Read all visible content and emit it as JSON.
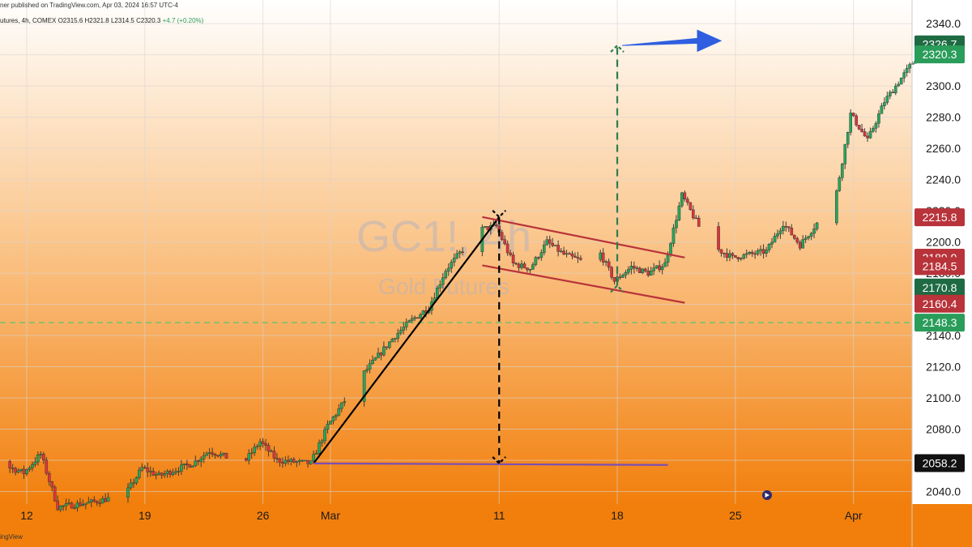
{
  "header": {
    "published": "ner published on TradingView.com, Apr 03, 2024 16:57 UTC-4",
    "ohlc": "utures, 4h, COMEX  O2315.6  H2321.8  L2314.5  C2320.3",
    "change": "+4.7 (+0.20%)"
  },
  "watermark": {
    "symbol": "GC1!, 4h",
    "name": "Gold Futures"
  },
  "footer": {
    "brand": "ingView"
  },
  "colors": {
    "up": "#26a65b",
    "down": "#d9363e",
    "trend": "#b8333a",
    "arrow": "#2f5fe0",
    "projection": "#2e7d4f",
    "baseline": "#7a4fb5",
    "bg_top": "#ffffff",
    "bg_bottom": "#f27f0c"
  },
  "icons": {
    "replay": "replay-icon"
  },
  "chart_data": {
    "type": "candlestick",
    "x_axis": {
      "labels": [
        {
          "text": "12",
          "date": "2024-02-12"
        },
        {
          "text": "19",
          "date": "2024-02-19"
        },
        {
          "text": "26",
          "date": "2024-02-26"
        },
        {
          "text": "Mar",
          "date": "2024-03-01"
        },
        {
          "text": "11",
          "date": "2024-03-11"
        },
        {
          "text": "18",
          "date": "2024-03-18"
        },
        {
          "text": "25",
          "date": "2024-03-25"
        },
        {
          "text": "Apr",
          "date": "2024-04-01"
        }
      ]
    },
    "y_axis": {
      "ylim": [
        2030,
        2345
      ],
      "ticks": [
        2040,
        2060,
        2080,
        2100,
        2120,
        2140,
        2160,
        2180,
        2200,
        2220,
        2240,
        2260,
        2280,
        2300,
        2320,
        2340
      ],
      "tick_labels": [
        "2040.0",
        "2060.0",
        "2080.0",
        "2100.0",
        "2120.0",
        "2140.0",
        "2160.0",
        "2180.0",
        "2200.0",
        "2220.0",
        "2240.0",
        "2260.0",
        "2280.0",
        "2300.0",
        "2320.0",
        "2340.0"
      ]
    },
    "price_labels": [
      {
        "text": "2326.7",
        "value": 2326.7,
        "color": "#1e6b43"
      },
      {
        "text": "2320.3",
        "value": 2320.3,
        "color": "#2a9d5a"
      },
      {
        "text": "2215.8",
        "value": 2215.8,
        "color": "#b8333a"
      },
      {
        "text": "2189.9",
        "value": 2189.9,
        "color": "#b8333a"
      },
      {
        "text": "2184.5",
        "value": 2184.5,
        "color": "#b8333a"
      },
      {
        "text": "2170.8",
        "value": 2170.8,
        "color": "#1e6b43"
      },
      {
        "text": "2160.4",
        "value": 2160.4,
        "color": "#b8333a"
      },
      {
        "text": "2148.3",
        "value": 2148.3,
        "color": "#2a9d5a"
      },
      {
        "text": "2058.2",
        "value": 2058.2,
        "color": "#111111"
      }
    ],
    "reference_lines": [
      {
        "value": 2148.3,
        "style": "dashed",
        "color": "#8fbf6a"
      }
    ],
    "annotations": [
      {
        "type": "line",
        "points": [
          [
            "2024-02-29",
            2058
          ],
          [
            "2024-03-11",
            2216
          ]
        ],
        "color": "#000000"
      },
      {
        "type": "line",
        "points": [
          [
            "2024-02-29",
            2058
          ],
          [
            "2024-03-21",
            2057
          ]
        ],
        "color": "#7a4fb5"
      },
      {
        "type": "line",
        "points": [
          [
            "2024-03-10",
            2216
          ],
          [
            "2024-03-22",
            2190
          ]
        ],
        "color": "#b8333a"
      },
      {
        "type": "line",
        "points": [
          [
            "2024-03-10",
            2185
          ],
          [
            "2024-03-22",
            2161
          ]
        ],
        "color": "#b8333a"
      },
      {
        "type": "measure",
        "points": [
          [
            "2024-03-11",
            2216
          ],
          [
            "2024-03-11",
            2058
          ]
        ],
        "color": "#000000"
      },
      {
        "type": "measure",
        "points": [
          [
            "2024-03-18",
            2172
          ],
          [
            "2024-03-18",
            2326
          ]
        ],
        "color": "#2e7d4f"
      },
      {
        "type": "arrow",
        "points": [
          [
            "2024-03-18",
            2326
          ],
          [
            "2024-03-24",
            2329
          ]
        ],
        "color": "#2f5fe0"
      }
    ],
    "keyframes": [
      {
        "date": "2024-02-08",
        "close": 2068
      },
      {
        "date": "2024-02-10",
        "close": 2060
      },
      {
        "date": "2024-02-12",
        "close": 2052
      },
      {
        "date": "2024-02-13",
        "close": 2064
      },
      {
        "date": "2024-02-14",
        "close": 2030
      },
      {
        "date": "2024-02-16",
        "close": 2033
      },
      {
        "date": "2024-02-18",
        "close": 2038
      },
      {
        "date": "2024-02-19",
        "close": 2055
      },
      {
        "date": "2024-02-20",
        "close": 2050
      },
      {
        "date": "2024-02-22",
        "close": 2058
      },
      {
        "date": "2024-02-23",
        "close": 2066
      },
      {
        "date": "2024-02-25",
        "close": 2058
      },
      {
        "date": "2024-02-26",
        "close": 2072
      },
      {
        "date": "2024-02-27",
        "close": 2060
      },
      {
        "date": "2024-02-29",
        "close": 2058
      },
      {
        "date": "2024-03-01",
        "close": 2082
      },
      {
        "date": "2024-03-03",
        "close": 2114
      },
      {
        "date": "2024-03-05",
        "close": 2140
      },
      {
        "date": "2024-03-06",
        "close": 2150
      },
      {
        "date": "2024-03-07",
        "close": 2158
      },
      {
        "date": "2024-03-08",
        "close": 2182
      },
      {
        "date": "2024-03-09",
        "close": 2195
      },
      {
        "date": "2024-03-10",
        "close": 2208
      },
      {
        "date": "2024-03-11",
        "close": 2210
      },
      {
        "date": "2024-03-12",
        "close": 2186
      },
      {
        "date": "2024-03-13",
        "close": 2183
      },
      {
        "date": "2024-03-14",
        "close": 2200
      },
      {
        "date": "2024-03-15",
        "close": 2192
      },
      {
        "date": "2024-03-16",
        "close": 2188
      },
      {
        "date": "2024-03-17",
        "close": 2196
      },
      {
        "date": "2024-03-18",
        "close": 2175
      },
      {
        "date": "2024-03-19",
        "close": 2184
      },
      {
        "date": "2024-03-20",
        "close": 2180
      },
      {
        "date": "2024-03-21",
        "close": 2186
      },
      {
        "date": "2024-03-22",
        "close": 2230
      },
      {
        "date": "2024-03-23",
        "close": 2210
      },
      {
        "date": "2024-03-24",
        "close": 2196
      },
      {
        "date": "2024-03-25",
        "close": 2190
      },
      {
        "date": "2024-03-27",
        "close": 2194
      },
      {
        "date": "2024-03-28",
        "close": 2212
      },
      {
        "date": "2024-03-29",
        "close": 2198
      },
      {
        "date": "2024-03-30",
        "close": 2212
      },
      {
        "date": "2024-03-31",
        "close": 2222
      },
      {
        "date": "2024-04-01",
        "close": 2282
      },
      {
        "date": "2024-04-02",
        "close": 2265
      },
      {
        "date": "2024-04-03",
        "close": 2290
      },
      {
        "date": "2024-04-04",
        "close": 2305
      },
      {
        "date": "2024-04-05",
        "close": 2320
      }
    ]
  }
}
